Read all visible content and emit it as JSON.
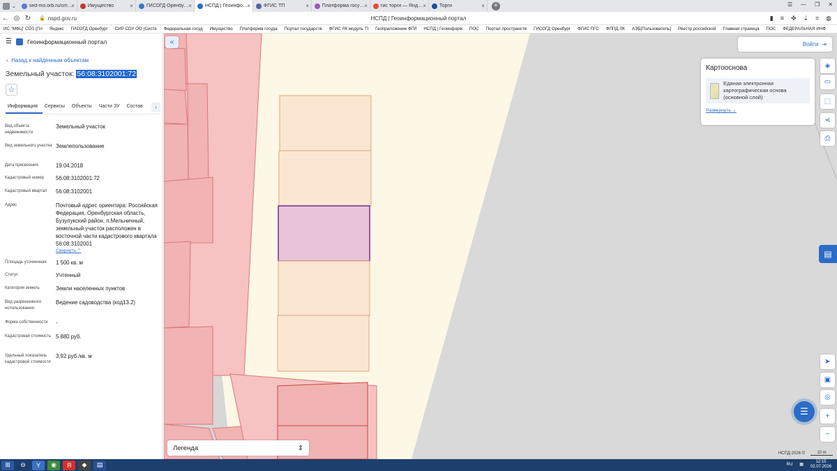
{
  "browser": {
    "tabs": [
      {
        "title": "sed-mo.orb.ru/cmj-web/",
        "color": "#5a7bd6"
      },
      {
        "title": "Имущество",
        "color": "#c0392b"
      },
      {
        "title": "ГИСОГД Оренбургской",
        "color": "#3a78c3"
      },
      {
        "title": "НСПД | Геоинформац",
        "color": "#2c6cc6",
        "active": true
      },
      {
        "title": "ФГИС ТП",
        "color": "#5463a8"
      },
      {
        "title": "Платформа государств",
        "color": "#9b59b6"
      },
      {
        "title": "гис торги — Яндекс: наш",
        "color": "#e74c3c"
      },
      {
        "title": "Торги",
        "color": "#1f4fa0"
      }
    ],
    "url": "nspd.gov.ru",
    "page_title": "НСПД | Геоинформационный портал",
    "bookmarks": [
      "ИС \"МФЦ\" СОЗ (Пл",
      "Яндекс",
      "ГИСОГД Оренбург",
      "СИР СОУ ОО (Систе",
      "Федеральная госуд",
      "Имущество",
      "Платформа госуда",
      "Портал государств",
      "ФГИС ЛК модуль 'П",
      "Геоприложение ФГИ",
      "НСПД | Геоинформ",
      "ПОС",
      "Портал пространств",
      "ГИСОГД Оренбург",
      "ФГИС ПГС",
      "ФППД ЛК",
      "АЭБ[Пользователь]",
      "Реестр российской",
      "Главная страница",
      "ПОС",
      "ФЕДЕРАЛЬНАЯ ИНФ"
    ]
  },
  "sidebar": {
    "portal_name": "Геоинформационный портал",
    "back_link": "Назад к найденным объектам",
    "title_prefix": "Земельный участок:",
    "title_number": "56:08:3102001:72",
    "tabs": [
      "Информация",
      "Сервисы",
      "Объекты",
      "Части ЗУ",
      "Состав"
    ],
    "properties": [
      {
        "key": "Вид объекта недвижимости",
        "value": "Земельный участок"
      },
      {
        "key": "Вид земельного участка",
        "value": "Землепользование"
      },
      {
        "key": "Дата присвоения",
        "value": "19.04.2018"
      },
      {
        "key": "Кадастровый номер",
        "value": "56:08:3102001:72"
      },
      {
        "key": "Кадастровый квартал",
        "value": "56:08:3102001"
      },
      {
        "key": "Адрес",
        "value": "Почтовый адрес ориентира: Российская Федерация, Оренбургская область, Бузулукский район, п.Мельничный, земельный участок расположен в восточной части кадастрового квартала 56:08:3102001"
      },
      {
        "key": "Площадь уточненная",
        "value": "1 500 кв. м"
      },
      {
        "key": "Статус",
        "value": "Учтенный"
      },
      {
        "key": "Категория земель",
        "value": "Земли населенных пунктов"
      },
      {
        "key": "Вид разрешенного использования",
        "value": "Ведение садоводства (код13.2)"
      },
      {
        "key": "Форма собственности",
        "value": "-"
      },
      {
        "key": "Кадастровая стоимость",
        "value": "5 880 руб."
      },
      {
        "key": "Удельный показатель кадастровой стоимости",
        "value": "3,92 руб./кв. м"
      }
    ],
    "collapse_label": "Свернуть"
  },
  "map": {
    "login_label": "Войти",
    "basemap_title": "Картооснова",
    "basemap_layer": "Единая электронная картографическая основа (основной слой)",
    "expand_label": "Развернуть",
    "legend_label": "Легенда",
    "copyright": "НСПД 2026 ©",
    "scale_label": "10 m",
    "colors": {
      "parcel_pink": "#f5b9b9",
      "parcel_orange": "#fbe6d2",
      "selected": "#e7c4d7",
      "selected_border": "#7a2c9a",
      "background": "#fdf8e6"
    }
  },
  "taskbar": {
    "lang": "RU",
    "time": "12:15",
    "date": "02.07.2026"
  }
}
